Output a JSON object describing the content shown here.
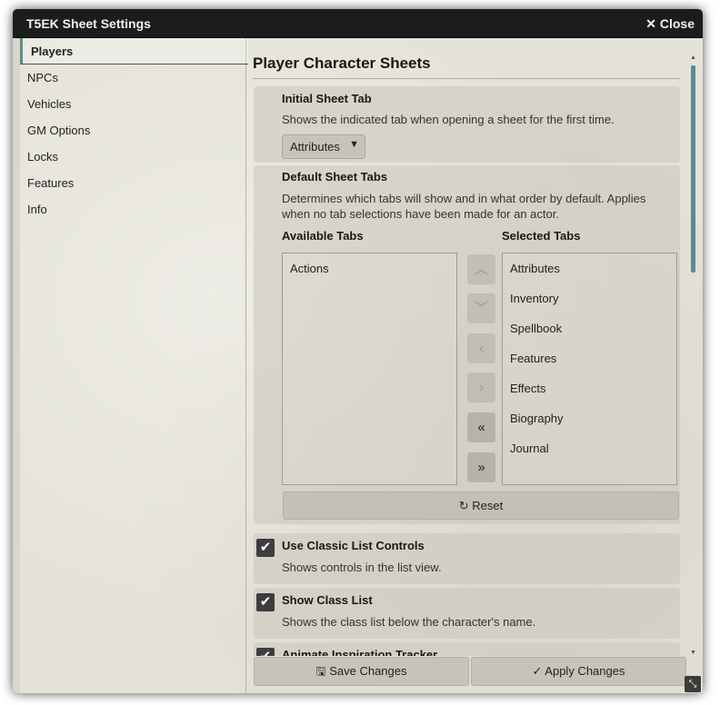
{
  "window": {
    "title": "T5EK Sheet Settings",
    "close_label": "✕ Close"
  },
  "sidebar": {
    "items": [
      {
        "label": "Players"
      },
      {
        "label": "NPCs"
      },
      {
        "label": "Vehicles"
      },
      {
        "label": "GM Options"
      },
      {
        "label": "Locks"
      },
      {
        "label": "Features"
      },
      {
        "label": "Info"
      }
    ],
    "active": "Players"
  },
  "main": {
    "section_title": "Player Character Sheets",
    "initial_tab": {
      "label": "Initial Sheet Tab",
      "description": "Shows the indicated tab when opening a sheet for the first time.",
      "selected": "Attributes"
    },
    "default_tabs": {
      "label": "Default Sheet Tabs",
      "description_line1": "Determines which tabs will show and in what order by default. Applies",
      "description_line2": "when no tab selections have been made for an actor.",
      "available_label": "Available Tabs",
      "selected_label": "Selected Tabs",
      "available": [
        "Actions"
      ],
      "selected": [
        "Attributes",
        "Inventory",
        "Spellbook",
        "Features",
        "Effects",
        "Biography",
        "Journal"
      ],
      "buttons": {
        "up": "︿",
        "down": "﹀",
        "left": "‹",
        "right": "›",
        "all_left": "«",
        "all_right": "»"
      },
      "reset_label": "↻ Reset"
    },
    "classic_list": {
      "label": "Use Classic List Controls",
      "description": "Shows controls in the list view.",
      "checked": true
    },
    "class_list": {
      "label": "Show Class List",
      "description": "Shows the class list below the character's name.",
      "checked": true
    },
    "inspiration": {
      "label": "Animate Inspiration Tracker",
      "checked": true
    }
  },
  "footer": {
    "save_label": "🖫 Save Changes",
    "apply_label": "✓ Apply Changes"
  },
  "colors": {
    "accent": "#5c8a90",
    "titlebar": "#1c1c1c",
    "checkbox": "#3d3d3d"
  }
}
